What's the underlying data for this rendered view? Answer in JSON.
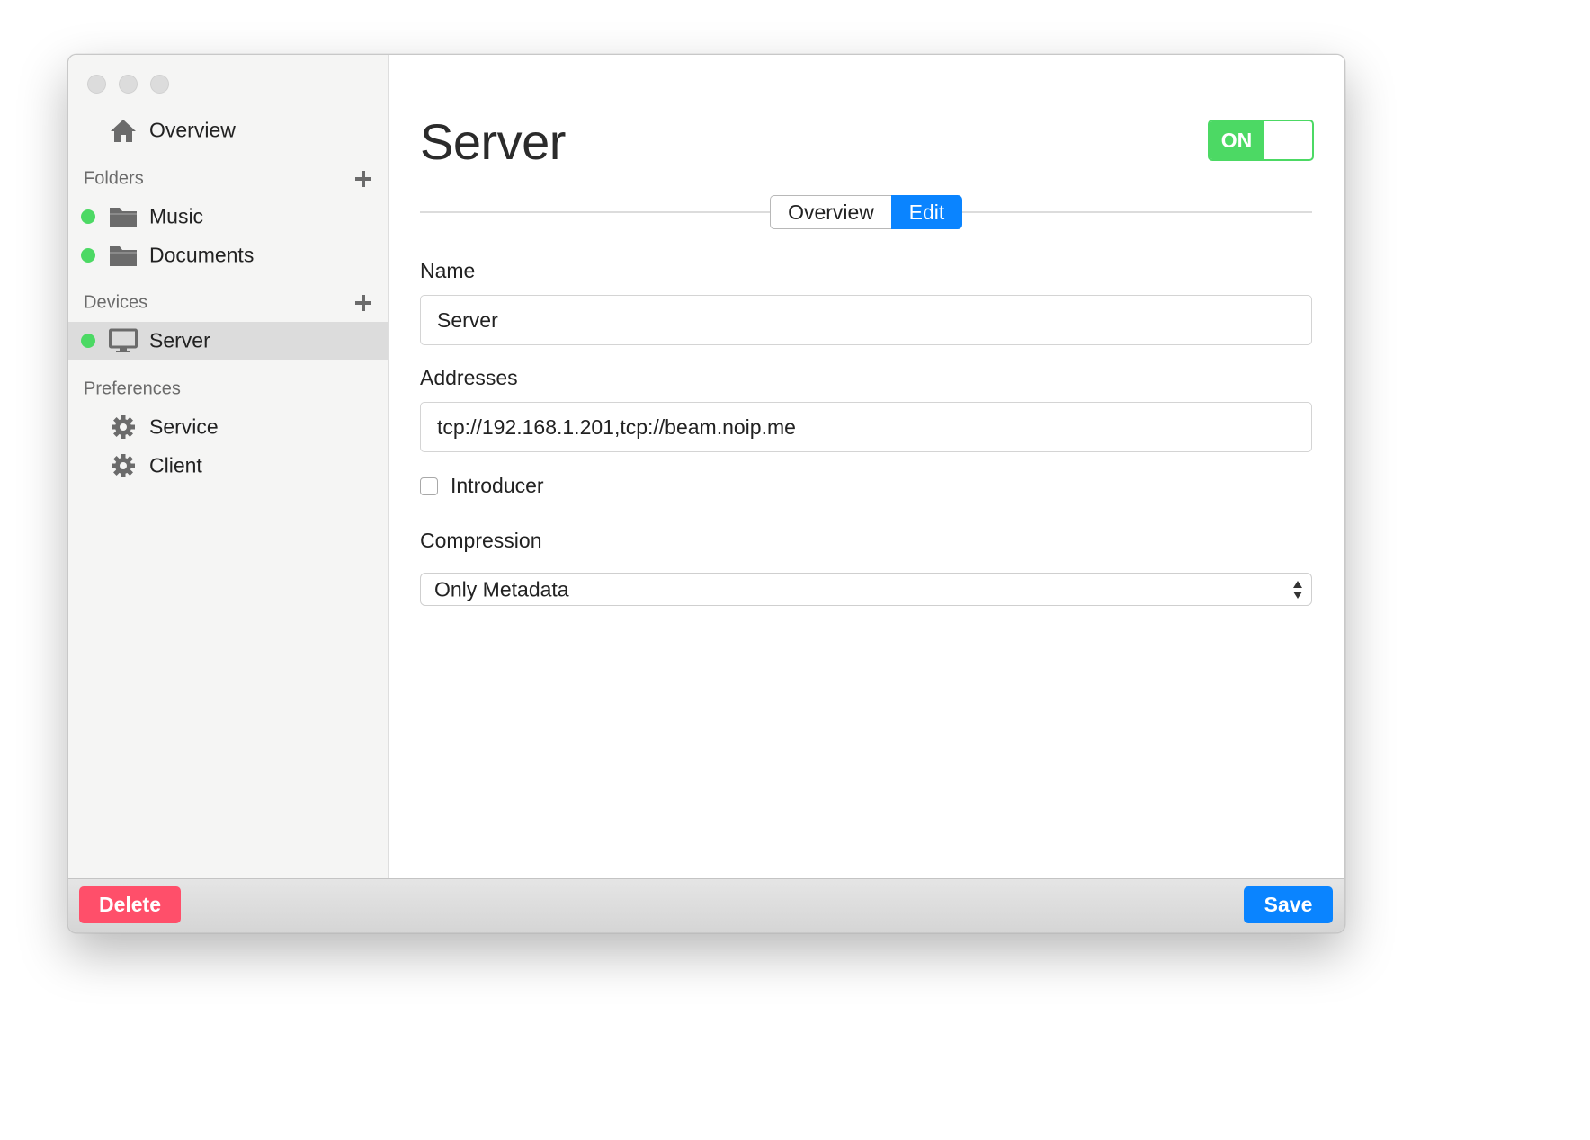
{
  "colors": {
    "accent": "#0a84ff",
    "online": "#4cd964",
    "danger": "#ff4f6a",
    "toggle_on": "#4cd964"
  },
  "sidebar": {
    "overview": {
      "label": "Overview",
      "icon": "home-icon"
    },
    "folders": {
      "title": "Folders",
      "add_icon": "plus-icon",
      "items": [
        {
          "label": "Music",
          "icon": "folder-icon",
          "status": "online"
        },
        {
          "label": "Documents",
          "icon": "folder-icon",
          "status": "online"
        }
      ]
    },
    "devices": {
      "title": "Devices",
      "add_icon": "plus-icon",
      "items": [
        {
          "label": "Server",
          "icon": "monitor-icon",
          "status": "online",
          "selected": true
        }
      ]
    },
    "preferences": {
      "title": "Preferences",
      "items": [
        {
          "label": "Service",
          "icon": "gear-icon"
        },
        {
          "label": "Client",
          "icon": "gear-icon"
        }
      ]
    }
  },
  "main": {
    "title": "Server",
    "toggle": {
      "label": "ON",
      "state": true
    },
    "tabs": [
      {
        "label": "Overview",
        "active": false
      },
      {
        "label": "Edit",
        "active": true
      }
    ],
    "form": {
      "name": {
        "label": "Name",
        "value": "Server"
      },
      "addresses": {
        "label": "Addresses",
        "value": "tcp://192.168.1.201,tcp://beam.noip.me"
      },
      "introducer": {
        "label": "Introducer",
        "checked": false
      },
      "compression": {
        "label": "Compression",
        "selected": "Only Metadata"
      }
    }
  },
  "footer": {
    "delete_label": "Delete",
    "save_label": "Save"
  }
}
